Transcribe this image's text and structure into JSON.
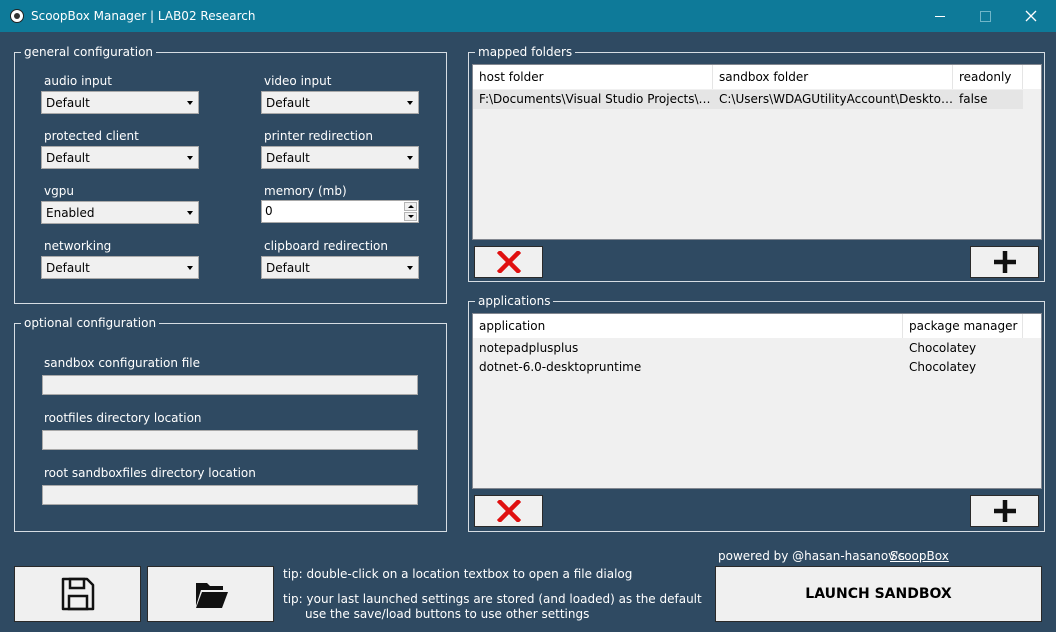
{
  "window": {
    "title": "ScoopBox Manager   |   LAB02 Research"
  },
  "general": {
    "legend": "general configuration",
    "audio_input": {
      "label": "audio input",
      "value": "Default"
    },
    "video_input": {
      "label": "video input",
      "value": "Default"
    },
    "protected_client": {
      "label": "protected client",
      "value": "Default"
    },
    "printer_redirection": {
      "label": "printer redirection",
      "value": "Default"
    },
    "vgpu": {
      "label": "vgpu",
      "value": "Enabled"
    },
    "memory": {
      "label": "memory (mb)",
      "value": "0"
    },
    "networking": {
      "label": "networking",
      "value": "Default"
    },
    "clipboard_redirection": {
      "label": "clipboard redirection",
      "value": "Default"
    }
  },
  "optional": {
    "legend": "optional configuration",
    "sandbox_config_file": {
      "label": "sandbox configuration file",
      "value": ""
    },
    "rootfiles_dir": {
      "label": "rootfiles directory location",
      "value": ""
    },
    "root_sandboxfiles_dir": {
      "label": "root sandboxfiles directory location",
      "value": ""
    }
  },
  "mapped_folders": {
    "legend": "mapped folders",
    "columns": [
      "host folder",
      "sandbox folder",
      "readonly"
    ],
    "rows": [
      [
        "F:\\Documents\\Visual Studio Projects\\HAS...",
        "C:\\Users\\WDAGUtilityAccount\\Desktop\\...",
        "false"
      ]
    ]
  },
  "applications": {
    "legend": "applications",
    "columns": [
      "application",
      "package manager"
    ],
    "rows": [
      [
        "notepadplusplus",
        "Chocolatey"
      ],
      [
        "dotnet-6.0-desktopruntime",
        "Chocolatey"
      ]
    ]
  },
  "footer": {
    "tip1": "tip: double-click on a location textbox to open a file dialog",
    "tip2": "tip: your last launched settings are stored (and loaded) as the default",
    "tip3": "use the save/load buttons to use other settings",
    "powered_by": "powered by @hasan-hasanov's",
    "powered_link": "ScoopBox",
    "launch_label": "LAUNCH SANDBOX"
  },
  "colors": {
    "background": "#2f4a62",
    "titlebar": "#0e7a99",
    "remove_icon": "#e01010"
  },
  "icons": {
    "remove": "x-icon",
    "add": "plus-icon",
    "save": "floppy-disk-icon",
    "load": "folder-open-icon"
  }
}
